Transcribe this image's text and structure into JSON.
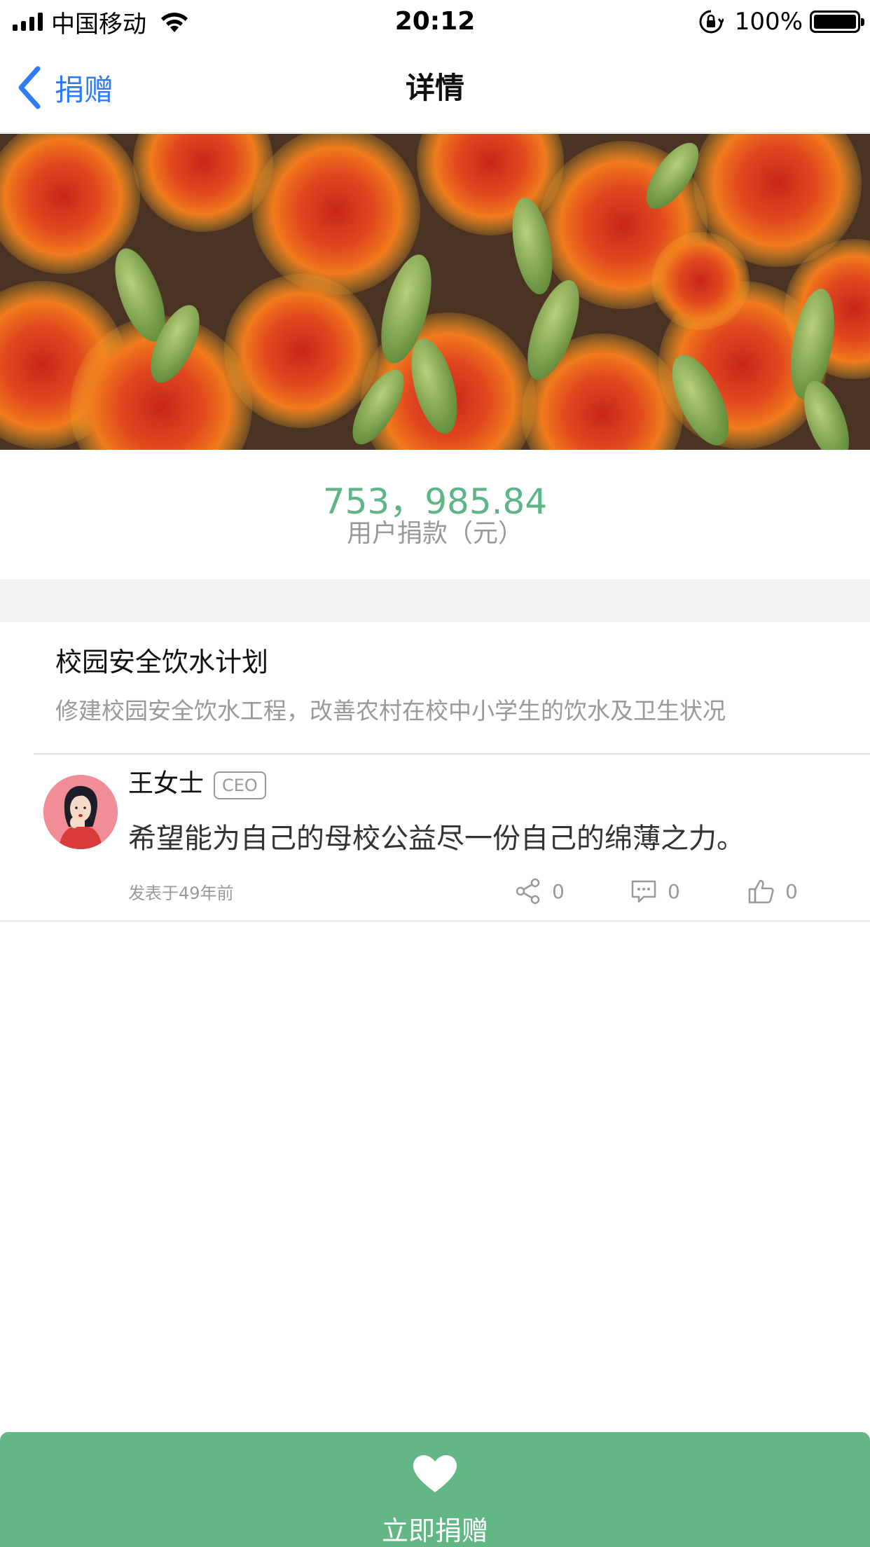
{
  "status_bar": {
    "carrier": "中国移动",
    "time": "20:12",
    "battery": "100%",
    "icons": [
      "signal-icon",
      "wifi-icon",
      "rotation-lock-icon",
      "battery-icon"
    ]
  },
  "nav": {
    "back_label": "捐赠",
    "title": "详情"
  },
  "hero": {
    "description": "protea-flowers-image"
  },
  "summary": {
    "amount": "753，985.84",
    "amount_label": "用户捐款（元）"
  },
  "project": {
    "title": "校园安全饮水计划",
    "description": "修建校园安全饮水工程，改善农村在校中小学生的饮水及卫生状况"
  },
  "comment": {
    "name": "王女士",
    "badge": "CEO",
    "text": "希望能为自己的母校公益尽一份自己的绵薄之力。",
    "time": "发表于49年前",
    "share_count": "0",
    "comment_count": "0",
    "like_count": "0"
  },
  "donate": {
    "label": "立即捐赠"
  },
  "colors": {
    "accent_green": "#62b785",
    "amount_green": "#5db585",
    "link_blue": "#2f7bf5"
  }
}
